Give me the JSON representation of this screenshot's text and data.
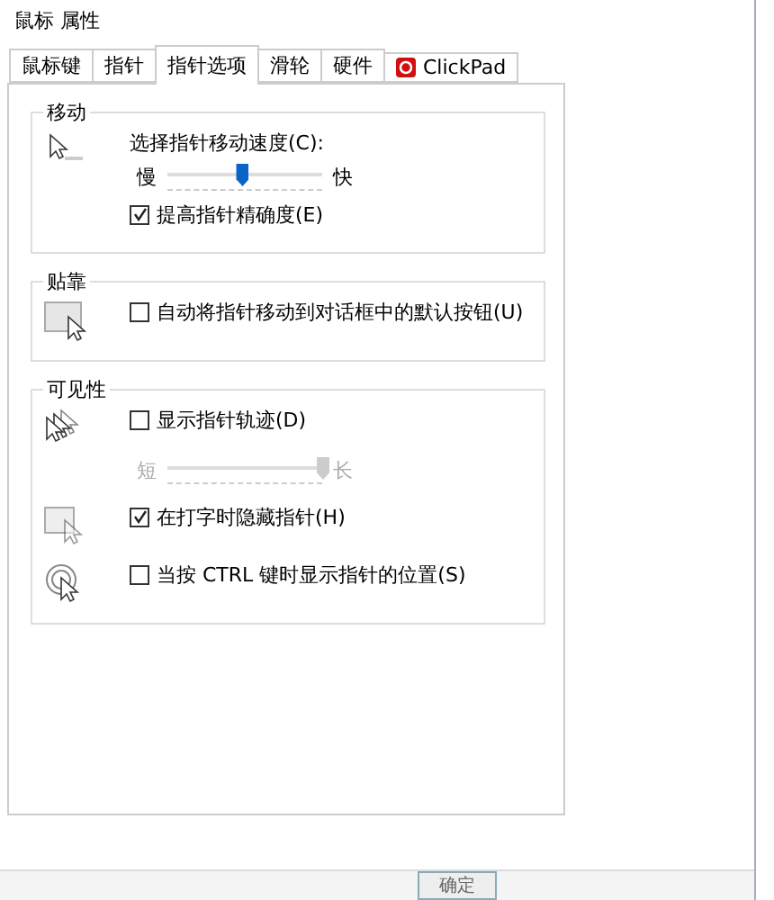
{
  "window": {
    "title": "鼠标 属性"
  },
  "tabs": [
    {
      "label": "鼠标键",
      "selected": false,
      "kind": "text"
    },
    {
      "label": "指针",
      "selected": false,
      "kind": "text"
    },
    {
      "label": "指针选项",
      "selected": true,
      "kind": "text"
    },
    {
      "label": "滑轮",
      "selected": false,
      "kind": "text"
    },
    {
      "label": "硬件",
      "selected": false,
      "kind": "text"
    },
    {
      "label": "ClickPad",
      "selected": false,
      "kind": "logo"
    }
  ],
  "groups": [
    {
      "title": "移动",
      "items": [
        {
          "kind": "slider",
          "label": "选择指针移动速度(C):",
          "min_label": "慢",
          "max_label": "快",
          "level": 0.48,
          "disabled": false
        },
        {
          "kind": "checkbox",
          "label": "提高指针精确度(E)",
          "checked": true
        }
      ]
    },
    {
      "title": "贴靠",
      "items": [
        {
          "kind": "checkbox",
          "label": "自动将指针移动到对话框中的默认按钮(U)",
          "checked": false
        }
      ]
    },
    {
      "title": "可见性",
      "items": [
        {
          "kind": "checkbox",
          "label": "显示指针轨迹(D)",
          "checked": false
        },
        {
          "kind": "slider",
          "min_label": "短",
          "max_label": "长",
          "level": 1,
          "disabled": true
        },
        {
          "kind": "checkbox",
          "label": "在打字时隐藏指针(H)",
          "checked": true
        },
        {
          "kind": "checkbox",
          "label": "当按 CTRL 键时显示指针的位置(S)",
          "checked": false
        }
      ]
    }
  ],
  "buttons": [
    {
      "label": "确定",
      "disabled": false
    }
  ]
}
